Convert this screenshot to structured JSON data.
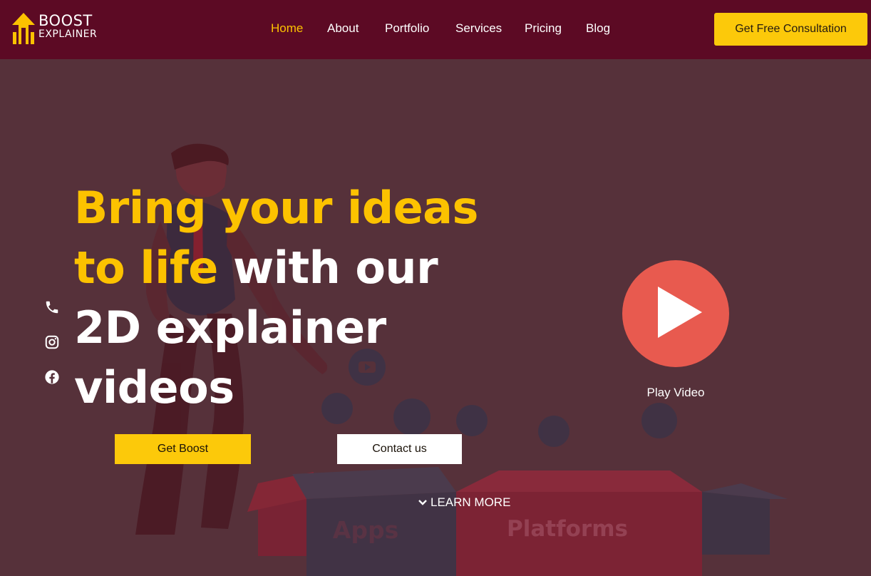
{
  "brand": {
    "logo_line1": "BOOST",
    "logo_line2": "EXPLAINER"
  },
  "nav": {
    "items": [
      {
        "label": "Home",
        "active": true
      },
      {
        "label": "About",
        "active": false
      },
      {
        "label": "Portfolio",
        "active": false
      },
      {
        "label": "Services",
        "active": false
      },
      {
        "label": "Pricing",
        "active": false
      },
      {
        "label": "Blog",
        "active": false
      }
    ],
    "cta_label": "Get Free Consultation"
  },
  "hero": {
    "headline": {
      "part1": "Bring your ideas",
      "part2_yellow": "to life",
      "part2_white": " with our",
      "part3": "2D explainer",
      "part4": "videos"
    },
    "primary_button": "Get Boost",
    "secondary_button": "Contact us",
    "learn_more": "LEARN MORE",
    "play_label": "Play Video",
    "background_words": [
      "Apps",
      "Platforms"
    ]
  },
  "social_icons": [
    "phone-icon",
    "instagram-icon",
    "facebook-icon"
  ],
  "colors": {
    "nav_bg": "#5c0a24",
    "hero_overlay": "#56313a",
    "accent_yellow": "#fcc200",
    "play_red": "#e85a4f"
  }
}
